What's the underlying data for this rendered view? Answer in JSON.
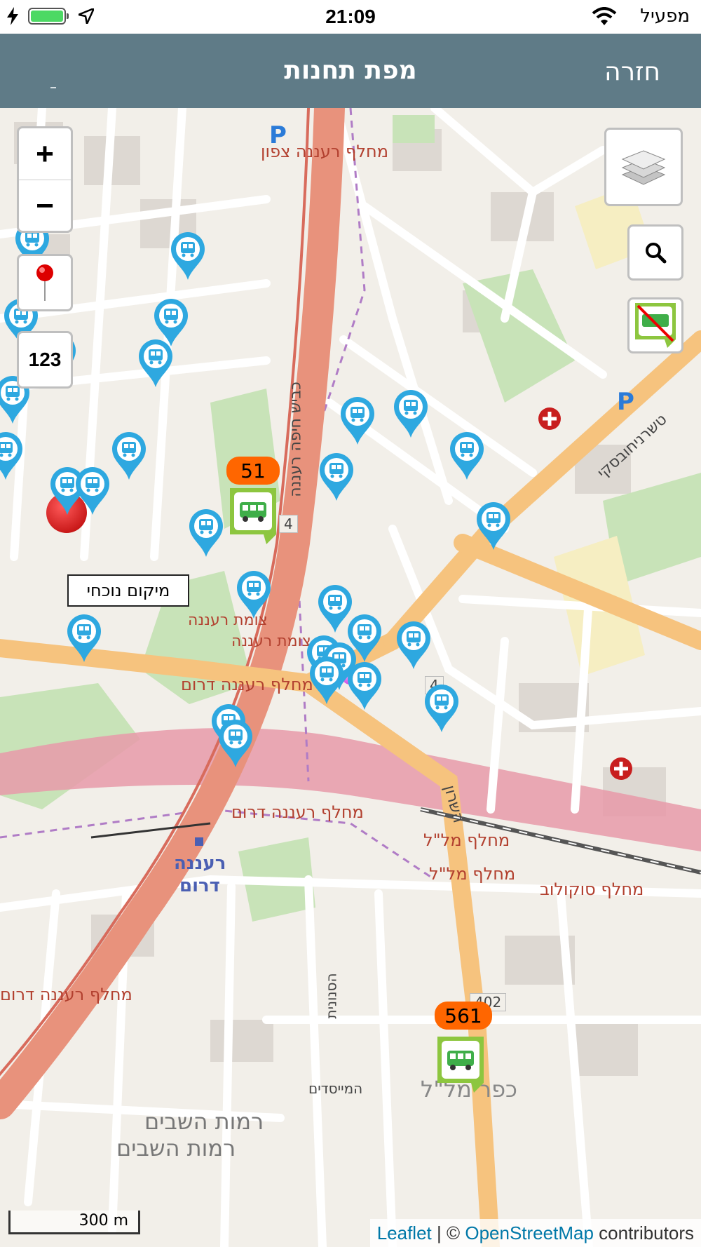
{
  "status_bar": {
    "time": "21:09",
    "carrier": "מפעיל",
    "battery_level": 1.0,
    "icons": [
      "charging-bolt-icon",
      "battery-icon",
      "location-arrow-icon",
      "wifi-icon"
    ]
  },
  "nav": {
    "title": "מפת תחנות",
    "back_label": "חזרה"
  },
  "map_controls": {
    "zoom_in": "+",
    "zoom_out": "−",
    "stop_numbers_label": "123",
    "icons": [
      "layers-icon",
      "search-icon",
      "hide-bus-icon",
      "location-pin-icon"
    ]
  },
  "current_location_label": "מיקום נוכחי",
  "bus_badges": [
    {
      "label": "51"
    },
    {
      "label": "561"
    }
  ],
  "map_labels": {
    "ra_north": "מחלף רעננה צפון",
    "highway_haifa": "כביש חיפה רעננה",
    "ra_south": "מחלף רעננה דרום",
    "ra_south_2": "מחלף רעננה דרום",
    "ra_south_3": "מחלף רעננה דרום",
    "tsomet": "צומת רעננה",
    "tsomet2": "צומת רעננה",
    "mall1": "מחלף מל\"ל",
    "mall2": "מחלף מל\"ל",
    "sokolov": "מחלף סוקולוב",
    "raanana_station": "רעננה",
    "raanana_station2": "דרום",
    "kfar_malal": "כפר מל\"ל",
    "ramot1": "רמות השבים",
    "ramot2": "רמות השבים",
    "tchernichovsky": "טשרניחובסקי",
    "hasharon": "השרון",
    "road4a": "4",
    "road4b": "4",
    "road402": "402",
    "hamisdim": "המייסדים",
    "hasnunit": "הסנונית"
  },
  "scale_label": "300 m",
  "attribution": {
    "leaflet": "Leaflet",
    "sep": " | © ",
    "osm": "OpenStreetMap",
    "contributors": " contributors"
  }
}
